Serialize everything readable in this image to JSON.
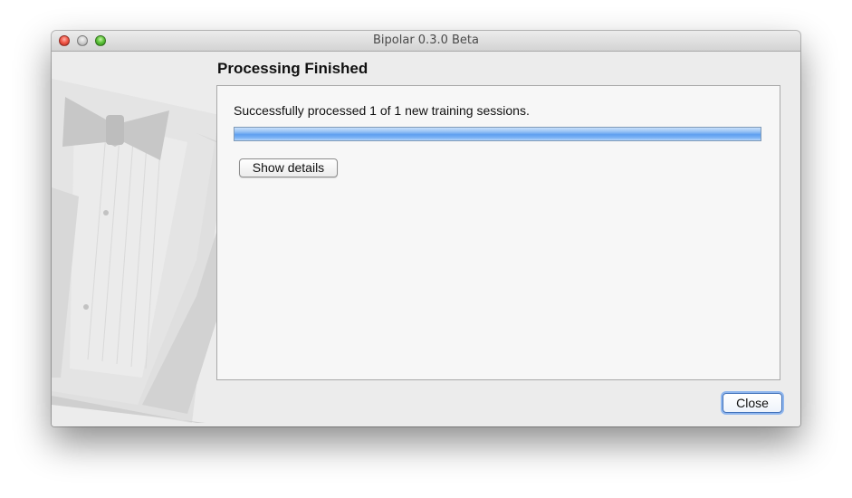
{
  "window": {
    "title": "Bipolar 0.3.0 Beta",
    "controls": {
      "close_icon": "close-traffic-light-icon",
      "minimize_icon": "minimize-traffic-light-icon",
      "zoom_icon": "zoom-traffic-light-icon"
    }
  },
  "main": {
    "heading": "Processing Finished",
    "status_message": "Successfully processed 1 of 1 new training sessions.",
    "progress": {
      "fraction": 1.0,
      "color": "#5e9ff0"
    },
    "show_details_label": "Show details"
  },
  "footer": {
    "close_label": "Close"
  },
  "decoration": {
    "illustration": "tuxedo-bowtie-icon"
  }
}
